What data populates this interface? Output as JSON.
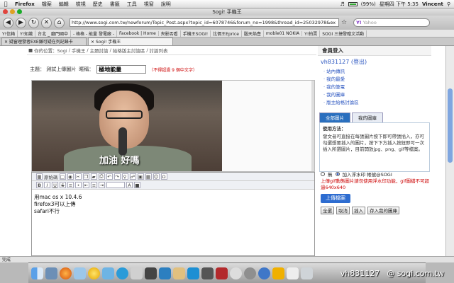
{
  "menubar": {
    "app": "Firefox",
    "items": [
      "檔案",
      "編輯",
      "檢視",
      "歷史",
      "書籤",
      "工具",
      "視窗",
      "說明"
    ],
    "battery": "(99%)",
    "clock": "星期四 下午 5:35",
    "user": "Vincent"
  },
  "window": {
    "title": "Sogi! 手機王"
  },
  "toolbar": {
    "url": "http://www.sogi.com.tw/newforum/Topic_Post.aspx?topic_id=6078746&forum_no=1998&thread_id=25032978&ex",
    "search_placeholder": "Yahoo"
  },
  "bookmarks": [
    "Y!信箱",
    "Y!知識",
    "台北 _ 廳門國中",
    "- 格格 - 能量 發電廠 -",
    "Facebook | Home",
    "夾影否看",
    "手機王SOGI!",
    "比價王Eprice",
    "腦天焰壺",
    "moble01 NOKIA",
    "Y!拍賣",
    "SOGI 三捷發贈文活動"
  ],
  "tabs": [
    {
      "label": "疑窗理發者EXE嫌可疑在列記錄卡"
    },
    {
      "label": "Sogi! 手機王"
    }
  ],
  "breadcrumb": {
    "items": [
      "你的位置：Sogi",
      "手機王",
      "主題討論",
      "給格版主討論區",
      "討論列表"
    ]
  },
  "post": {
    "subject_label": "主題： 測試上傳圖片",
    "mood_label": "暱稱：",
    "subject_value": "極地能量",
    "subject_hint": "（不得超過 9 個中文字）",
    "caption": "加油 好嗎",
    "body": [
      "用mac os x 10.4.6",
      "firefox3可以上傳",
      "safari不行"
    ]
  },
  "editor": {
    "toolbar_label": "原始碼"
  },
  "sidebar": {
    "member_title": "會員登入",
    "user": "vh831127",
    "logout": "(登出)",
    "menu": [
      "站內傳訊",
      "我的最愛",
      "我的筆電",
      "我的圖庫",
      "版主給格討論區"
    ],
    "tabs": [
      "全部圖片",
      "我的圖庫"
    ],
    "usage_title": "使用方法：",
    "usage_text": "發文者可直接在每張圖片按下即可帶張插入，亦可勾選想要插入的圖片，按下下方插入按鈕即可一次插入所選圖片，目前開放jpg、png、gif等檔案。",
    "opt_no": "無",
    "opt_watermark": "加入浮水印 帳號@SOGI",
    "warning": "上傳gif動態圖片請勿使用浮水印功能，gif圖檔不可超過640x640",
    "upload_btn": "上傳檔案",
    "buttons": [
      "全選",
      "取消",
      "插入",
      "存入我的圖庫"
    ]
  },
  "status": {
    "text": "完成"
  },
  "watermark": {
    "user": "vh831127",
    "site": "@ sogi.com.tw"
  },
  "colors": {
    "accent": "#2d6cd0",
    "warning": "#cc0000"
  }
}
